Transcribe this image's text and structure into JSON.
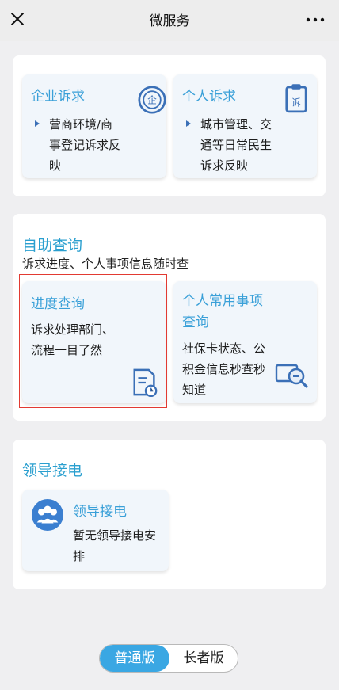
{
  "header": {
    "title": "微服务"
  },
  "complaints": {
    "enterprise": {
      "title": "企业诉求",
      "desc_line1": "营商环境/商",
      "desc_line2": "事登记诉求反",
      "desc_line3": "映",
      "icon_glyph": "企"
    },
    "personal": {
      "title": "个人诉求",
      "desc_line1": "城市管理、交",
      "desc_line2": "通等日常民生",
      "desc_line3": "诉求反映",
      "icon_glyph": "诉"
    }
  },
  "self_query": {
    "title": "自助查询",
    "subtitle": "诉求进度、个人事项信息随时查",
    "progress": {
      "title": "进度查询",
      "desc_line1": "诉求处理部门、",
      "desc_line2": "流程一目了然"
    },
    "personal_items": {
      "title_line1": "个人常用事项",
      "title_line2": "查询",
      "desc_line1": "社保卡状态、公",
      "desc_line2": "积金信息秒查秒",
      "desc_line3": "知道"
    }
  },
  "leader": {
    "title": "领导接电",
    "card": {
      "title": "领导接电",
      "desc_line1": "暂无领导接电安",
      "desc_line2": "排"
    }
  },
  "mode_toggle": {
    "normal": "普通版",
    "elder": "长者版",
    "active": "normal"
  },
  "colors": {
    "accent": "#3aa0d8",
    "icon_blue": "#3b70b7",
    "highlight_border": "#e23a32",
    "toggle_active": "#3aa7e3"
  }
}
